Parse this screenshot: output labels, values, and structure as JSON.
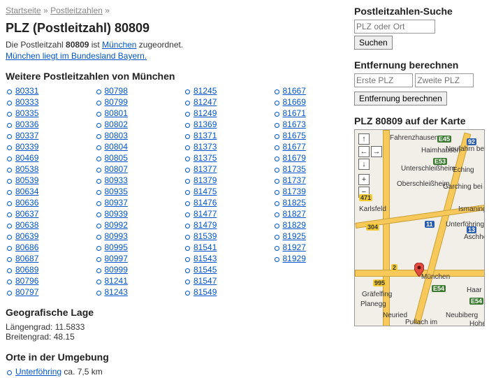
{
  "breadcrumb": {
    "home": "Startseite",
    "section": "Postleitzahlen",
    "sep": "»"
  },
  "title": "PLZ (Postleitzahl) 80809",
  "intro1a": "Die Postleitzahl ",
  "intro1b": "80809",
  "intro1c": " ist ",
  "intro1city": "München",
  "intro1d": " zugeordnet.",
  "intro2": "München liegt im Bundesland Bayern.",
  "more_heading": "Weitere Postleitzahlen von München",
  "plz": [
    "80331",
    "80333",
    "80335",
    "80336",
    "80337",
    "80339",
    "80469",
    "80538",
    "80539",
    "80634",
    "80636",
    "80637",
    "80638",
    "80639",
    "80686",
    "80687",
    "80689",
    "80796",
    "80797",
    "80798",
    "80799",
    "80801",
    "80802",
    "80803",
    "80804",
    "80805",
    "80807",
    "80933",
    "80935",
    "80937",
    "80939",
    "80992",
    "80993",
    "80995",
    "80997",
    "80999",
    "81241",
    "81243",
    "81245",
    "81247",
    "81249",
    "81369",
    "81371",
    "81373",
    "81375",
    "81377",
    "81379",
    "81475",
    "81476",
    "81477",
    "81479",
    "81539",
    "81541",
    "81543",
    "81545",
    "81547",
    "81549",
    "81667",
    "81669",
    "81671",
    "81673",
    "81675",
    "81677",
    "81679",
    "81735",
    "81737",
    "81739",
    "81825",
    "81827",
    "81829",
    "81925",
    "81927",
    "81929"
  ],
  "geo_heading": "Geografische Lage",
  "geo": {
    "lng_label": "Längengrad:",
    "lng": "11.5833",
    "lat_label": "Breitengrad:",
    "lat": "48.15"
  },
  "near_heading": "Orte in der Umgebung",
  "near": {
    "name": "Unterföhring",
    "dist": "ca. 7,5 km"
  },
  "search": {
    "heading": "Postleitzahlen-Suche",
    "placeholder": "PLZ oder Ort",
    "button": "Suchen"
  },
  "distance": {
    "heading": "Entfernung berechnen",
    "pl1": "Erste PLZ",
    "pl2": "Zweite PLZ",
    "button": "Entfernung berechnen"
  },
  "map_heading": "PLZ 80809 auf der Karte",
  "map": {
    "cities": [
      "Fahrenzhausen",
      "Haimhausen",
      "Neufahrn bei Freising",
      "Unterschleißheim",
      "Eching",
      "Oberschleißheim",
      "Garching bei München",
      "Karlsfeld",
      "Ismaning",
      "Unterföhring",
      "Aschheim",
      "München",
      "Gräfelfing",
      "Planegg",
      "Neuried",
      "Pullach im",
      "Neubiberg",
      "Hohenbrunn",
      "Haar"
    ],
    "badges": [
      "E45",
      "92",
      "E53",
      "471",
      "304",
      "11",
      "13",
      "2",
      "E54",
      "995",
      "E54"
    ],
    "pin": "München"
  }
}
